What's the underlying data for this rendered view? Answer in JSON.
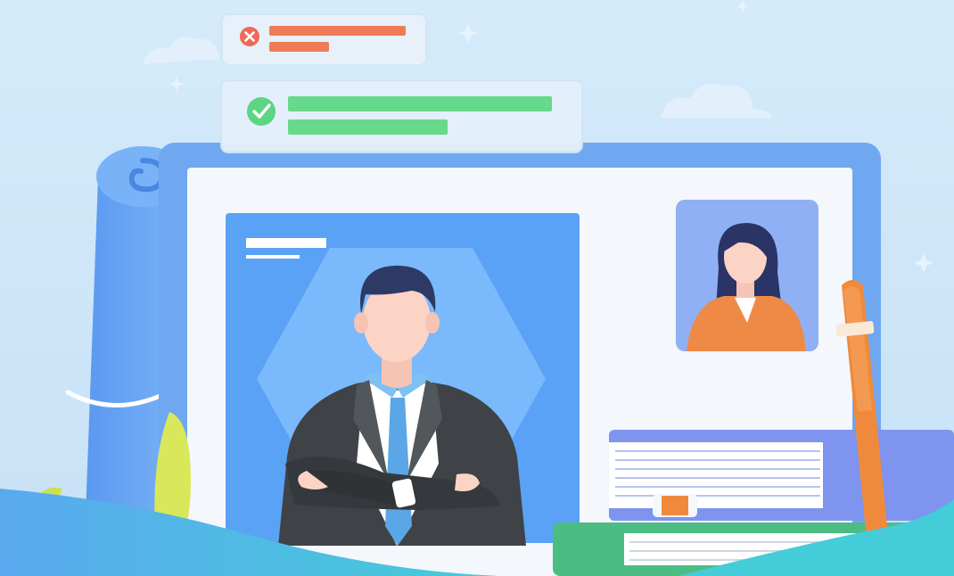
{
  "illustration": {
    "colors": {
      "sky_top": "#d4ebfb",
      "sky_bottom": "#c7e1f6",
      "monitor_frame": "#6fa8f1",
      "screen": "#f4f8fc",
      "photo_bg": "#5aa2f5",
      "hexagon": "#7ab9fb",
      "error_red": "#ee6b57",
      "success_green": "#5ed583",
      "suit": "#3f4347",
      "tie": "#5aa6e6",
      "skin": "#fbd4c6",
      "hair": "#2e3a66",
      "woman_top": "#ee8a45",
      "pencil": "#ef8a3c",
      "book_green": "#4bbd83",
      "scroll_blue": "#5f9ef3",
      "plant_yellow": "#d9e85a",
      "wave_teal": "#3fc8d6"
    },
    "elements": [
      "error-notification-card",
      "success-notification-card",
      "monitor",
      "candidate-photo-card",
      "businessman-figure",
      "applicant-thumbnail",
      "rolled-document",
      "pencil",
      "book-stack",
      "plant"
    ]
  }
}
